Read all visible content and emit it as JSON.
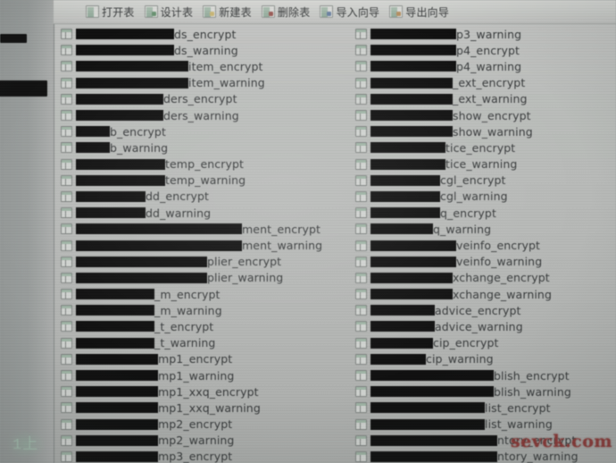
{
  "window": {
    "background_color": "#b2b6b2",
    "sidebar_color": "#949b99"
  },
  "toolbar": {
    "items": [
      {
        "label": "打开表",
        "icon": "open-table-icon",
        "badge": "none"
      },
      {
        "label": "设计表",
        "icon": "design-table-icon",
        "badge": "green"
      },
      {
        "label": "新建表",
        "icon": "new-table-icon",
        "badge": "yellow"
      },
      {
        "label": "删除表",
        "icon": "delete-table-icon",
        "badge": "red"
      },
      {
        "label": "导入向导",
        "icon": "import-wizard-icon",
        "badge": "blue"
      },
      {
        "label": "导出向导",
        "icon": "export-wizard-icon",
        "badge": "orange"
      }
    ]
  },
  "sidebar": {
    "redacted_blocks": [
      {
        "name": "sidebar-redaction-top"
      },
      {
        "name": "sidebar-redaction-second"
      }
    ],
    "bottom_glyph": "1上"
  },
  "table_list": {
    "icon_name": "table-icon",
    "columns": [
      {
        "name": "left-column",
        "rows": [
          {
            "redaction_width": 110,
            "suffix": "ds_encrypt"
          },
          {
            "redaction_width": 110,
            "suffix": "ds_warning"
          },
          {
            "redaction_width": 126,
            "suffix": "item_encrypt"
          },
          {
            "redaction_width": 126,
            "suffix": "item_warning"
          },
          {
            "redaction_width": 98,
            "suffix": "ders_encrypt"
          },
          {
            "redaction_width": 98,
            "suffix": "ders_warning"
          },
          {
            "redaction_width": 38,
            "suffix": "b_encrypt"
          },
          {
            "redaction_width": 38,
            "suffix": "b_warning"
          },
          {
            "redaction_width": 100,
            "suffix": "temp_encrypt"
          },
          {
            "redaction_width": 100,
            "suffix": "temp_warning"
          },
          {
            "redaction_width": 78,
            "suffix": "dd_encrypt"
          },
          {
            "redaction_width": 78,
            "suffix": "dd_warning"
          },
          {
            "redaction_width": 186,
            "suffix": "ment_encrypt"
          },
          {
            "redaction_width": 186,
            "suffix": "ment_warning"
          },
          {
            "redaction_width": 147,
            "suffix": "plier_encrypt"
          },
          {
            "redaction_width": 147,
            "suffix": "plier_warning"
          },
          {
            "redaction_width": 88,
            "suffix": "_m_encrypt"
          },
          {
            "redaction_width": 88,
            "suffix": "_m_warning"
          },
          {
            "redaction_width": 88,
            "suffix": "_t_encrypt"
          },
          {
            "redaction_width": 88,
            "suffix": "_t_warning"
          },
          {
            "redaction_width": 92,
            "suffix": "mp1_encrypt"
          },
          {
            "redaction_width": 92,
            "suffix": "mp1_warning"
          },
          {
            "redaction_width": 92,
            "suffix": "mp1_xxq_encrypt"
          },
          {
            "redaction_width": 92,
            "suffix": "mp1_xxq_warning"
          },
          {
            "redaction_width": 92,
            "suffix": "mp2_encrypt"
          },
          {
            "redaction_width": 92,
            "suffix": "mp2_warning"
          },
          {
            "redaction_width": 92,
            "suffix": "mp3_encrypt"
          }
        ]
      },
      {
        "name": "right-column",
        "rows": [
          {
            "redaction_width": 96,
            "suffix": "p3_warning"
          },
          {
            "redaction_width": 96,
            "suffix": "p4_encrypt"
          },
          {
            "redaction_width": 96,
            "suffix": "p4_warning"
          },
          {
            "redaction_width": 92,
            "suffix": "_ext_encrypt"
          },
          {
            "redaction_width": 92,
            "suffix": "_ext_warning"
          },
          {
            "redaction_width": 92,
            "suffix": "show_encrypt"
          },
          {
            "redaction_width": 92,
            "suffix": "show_warning"
          },
          {
            "redaction_width": 84,
            "suffix": "tice_encrypt"
          },
          {
            "redaction_width": 84,
            "suffix": "tice_warning"
          },
          {
            "redaction_width": 78,
            "suffix": "cgl_encrypt"
          },
          {
            "redaction_width": 78,
            "suffix": "cgl_warning"
          },
          {
            "redaction_width": 78,
            "suffix": "q_encrypt"
          },
          {
            "redaction_width": 70,
            "suffix": "q_warning"
          },
          {
            "redaction_width": 96,
            "suffix": "veinfo_encrypt"
          },
          {
            "redaction_width": 96,
            "suffix": "veinfo_warning"
          },
          {
            "redaction_width": 92,
            "suffix": "xchange_encrypt"
          },
          {
            "redaction_width": 92,
            "suffix": "xchange_warning"
          },
          {
            "redaction_width": 72,
            "suffix": "advice_encrypt"
          },
          {
            "redaction_width": 72,
            "suffix": "advice_warning"
          },
          {
            "redaction_width": 70,
            "suffix": "cip_encrypt"
          },
          {
            "redaction_width": 62,
            "suffix": "cip_warning"
          },
          {
            "redaction_width": 138,
            "suffix": "blish_encrypt"
          },
          {
            "redaction_width": 138,
            "suffix": "blish_warning"
          },
          {
            "redaction_width": 128,
            "suffix": "list_encrypt"
          },
          {
            "redaction_width": 128,
            "suffix": "list_warning"
          },
          {
            "redaction_width": 142,
            "suffix": "ntory_encrypt"
          },
          {
            "redaction_width": 142,
            "suffix": "ntory_warning"
          }
        ]
      }
    ]
  },
  "watermark": {
    "text": "sevck.com",
    "color": "#c4221e"
  }
}
